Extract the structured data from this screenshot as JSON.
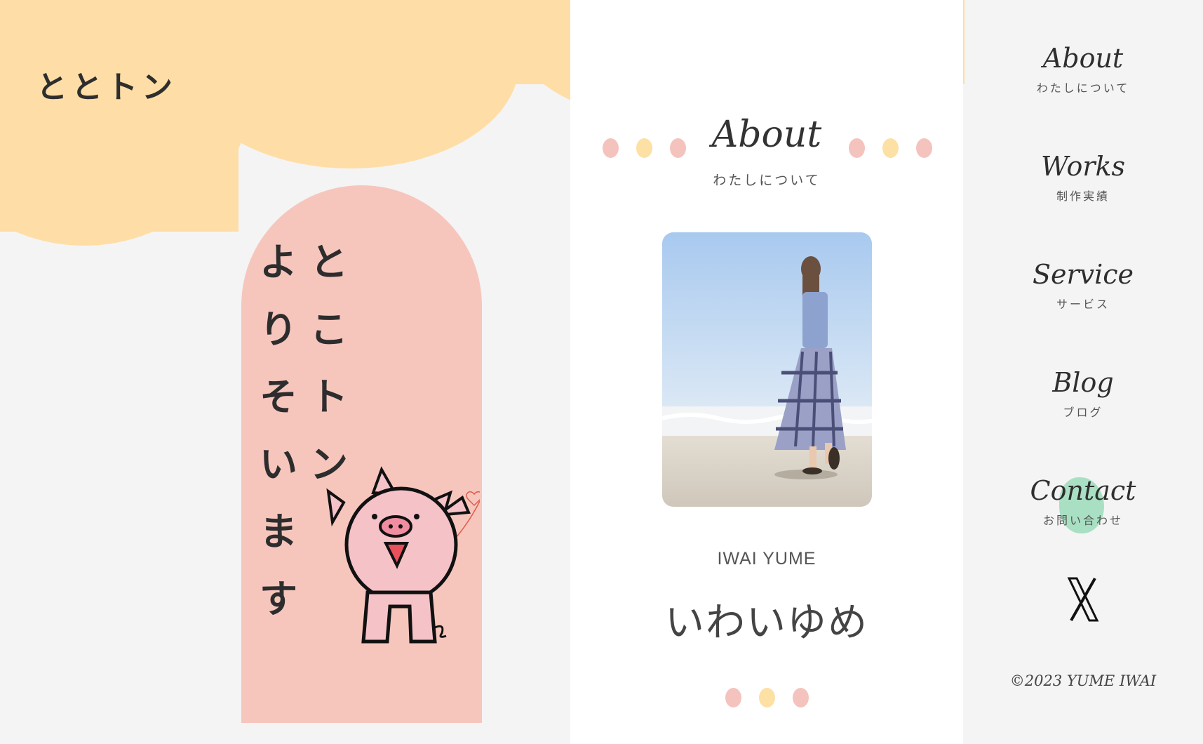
{
  "brand": {
    "logo": "ととトン"
  },
  "hero": {
    "line1": [
      "と",
      "こ",
      "ト",
      "ン"
    ],
    "line2": [
      "よ",
      "り",
      "そ",
      "い",
      "ま",
      "す"
    ]
  },
  "about": {
    "title": "About",
    "subtitle": "わたしについて",
    "name_en": "IWAI YUME",
    "name_jp": "いわいゆめ"
  },
  "nav": {
    "items": [
      {
        "en": "About",
        "jp": "わたしについて"
      },
      {
        "en": "Works",
        "jp": "制作実績"
      },
      {
        "en": "Service",
        "jp": "サービス"
      },
      {
        "en": "Blog",
        "jp": "ブログ"
      },
      {
        "en": "Contact",
        "jp": "お問い合わせ"
      }
    ],
    "social_icon": "x-icon",
    "copyright": "©2023 YUME IWAI"
  },
  "colors": {
    "cloud": "#fedea6",
    "arch": "#f6c6bd",
    "dot_pink": "#f5c3bd",
    "dot_yellow": "#fde0a4",
    "contact_accent": "#a9e0c4"
  }
}
